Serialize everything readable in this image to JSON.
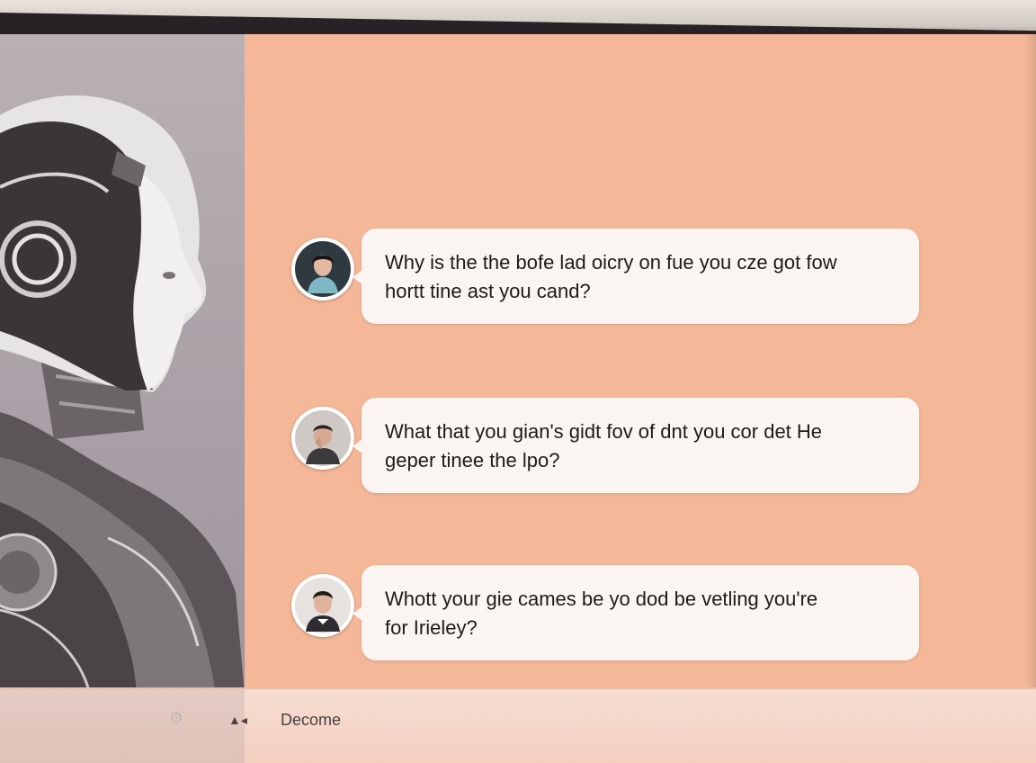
{
  "messages": [
    {
      "avatar": "woman-avatar",
      "line1": "Why is the the bofe lad oicry on fue you cze got fow",
      "line2": "hortt tine ast you cand?"
    },
    {
      "avatar": "man-avatar",
      "line1": "What that you gian's gidt fov of dnt you cor det He",
      "line2": "geper tinee the lpo?"
    },
    {
      "avatar": "man-avatar",
      "line1": "Whott your gie cames be yo dod be vetling you're",
      "line2": "for Irieley?"
    }
  ],
  "bottombar": {
    "left_icon": "settings-icon",
    "volume_icon": "speaker-icon",
    "label": "Decome"
  },
  "colors": {
    "chat_background": "#f4b797",
    "bubble": "#fbf5f2",
    "robot_panel": "#aaa2a7"
  }
}
